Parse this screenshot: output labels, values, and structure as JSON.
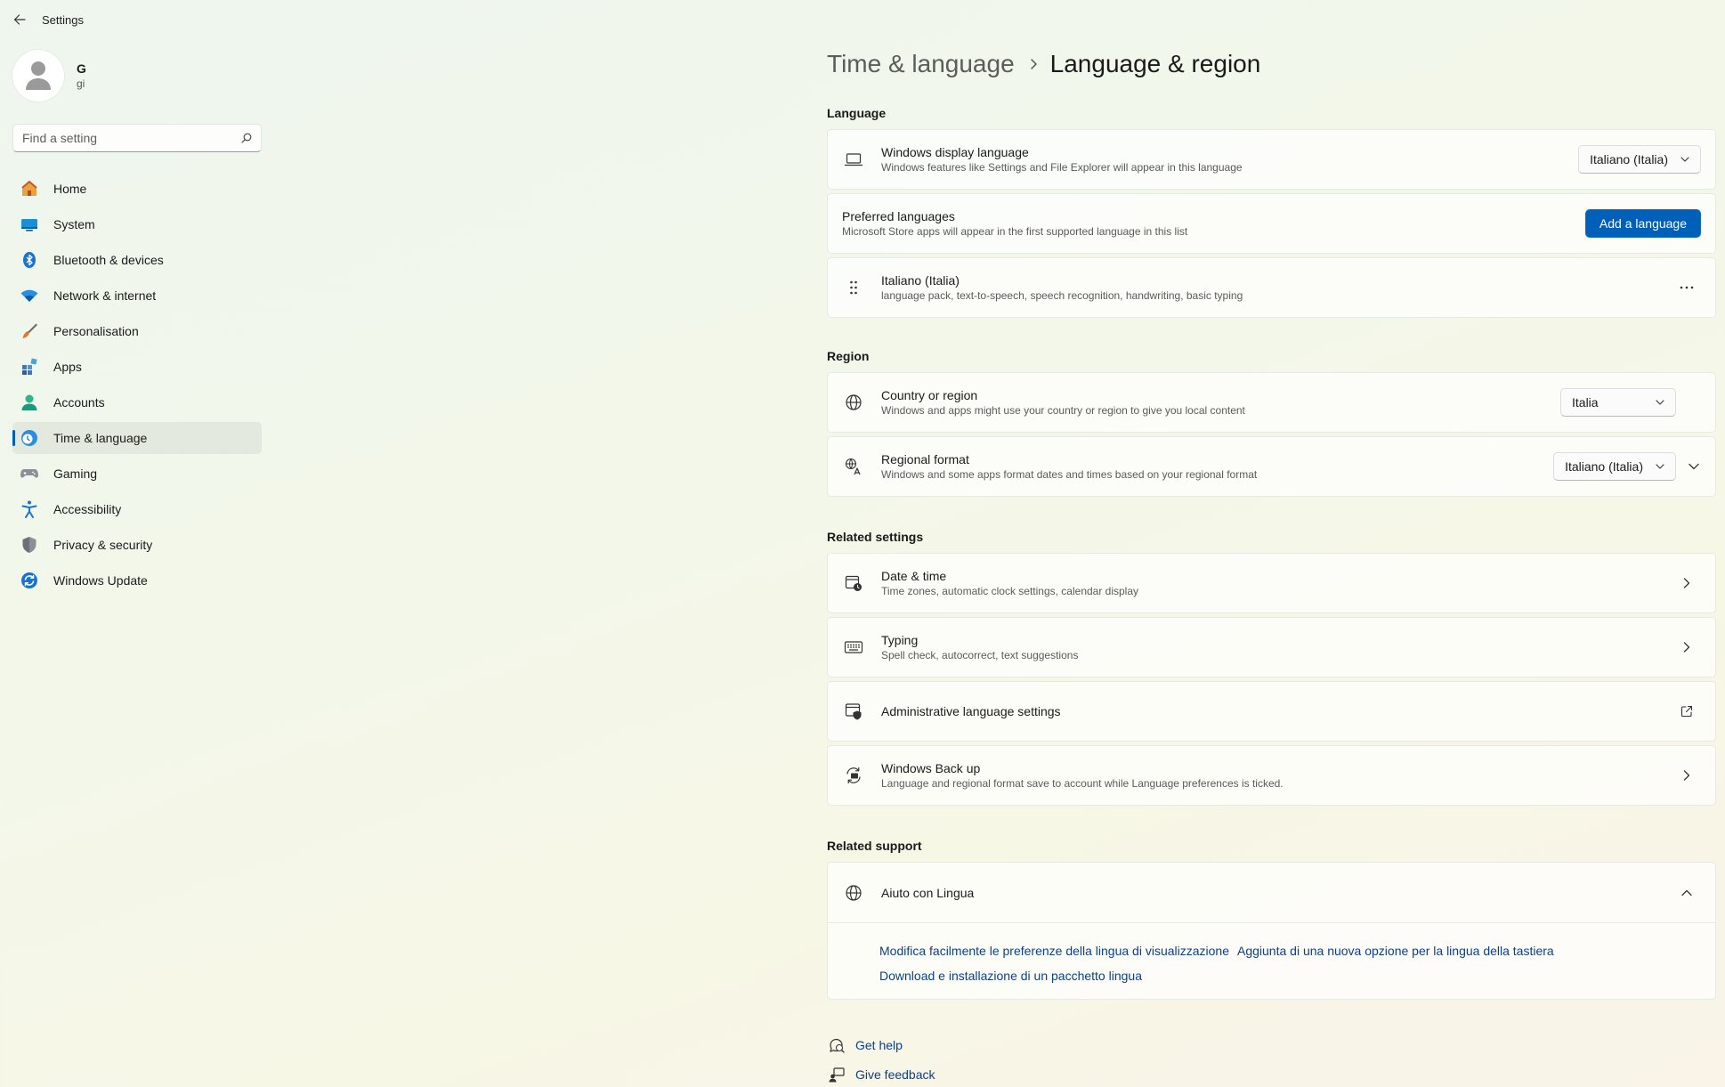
{
  "window": {
    "title": "Settings"
  },
  "profile": {
    "name": "G",
    "email": "gi"
  },
  "search": {
    "placeholder": "Find a setting"
  },
  "sidebar": {
    "items": [
      {
        "label": "Home",
        "icon": "home-icon"
      },
      {
        "label": "System",
        "icon": "system-icon"
      },
      {
        "label": "Bluetooth & devices",
        "icon": "bluetooth-icon"
      },
      {
        "label": "Network & internet",
        "icon": "wifi-icon"
      },
      {
        "label": "Personalisation",
        "icon": "brush-icon"
      },
      {
        "label": "Apps",
        "icon": "apps-icon"
      },
      {
        "label": "Accounts",
        "icon": "accounts-icon"
      },
      {
        "label": "Time & language",
        "icon": "time-language-icon",
        "active": true
      },
      {
        "label": "Gaming",
        "icon": "gamepad-icon"
      },
      {
        "label": "Accessibility",
        "icon": "accessibility-icon"
      },
      {
        "label": "Privacy & security",
        "icon": "shield-icon"
      },
      {
        "label": "Windows Update",
        "icon": "update-icon"
      }
    ]
  },
  "breadcrumb": {
    "parent": "Time & language",
    "current": "Language & region"
  },
  "language": {
    "section_label": "Language",
    "display_language": {
      "title": "Windows display language",
      "subtitle": "Windows features like Settings and File Explorer will appear in this language",
      "value": "Italiano (Italia)"
    },
    "preferred": {
      "title": "Preferred languages",
      "subtitle": "Microsoft Store apps will appear in the first supported language in this list",
      "button": "Add a language"
    },
    "installed": {
      "title": "Italiano (Italia)",
      "subtitle": "language pack, text-to-speech, speech recognition, handwriting, basic typing"
    }
  },
  "region": {
    "section_label": "Region",
    "country": {
      "title": "Country or region",
      "subtitle": "Windows and apps might use your country or region to give you local content",
      "value": "Italia"
    },
    "format": {
      "title": "Regional format",
      "subtitle": "Windows and some apps format dates and times based on your regional format",
      "value": "Italiano (Italia)"
    }
  },
  "related": {
    "section_label": "Related settings",
    "date_time": {
      "title": "Date & time",
      "subtitle": "Time zones, automatic clock settings, calendar display"
    },
    "typing": {
      "title": "Typing",
      "subtitle": "Spell check, autocorrect, text suggestions"
    },
    "admin": {
      "title": "Administrative language settings"
    },
    "backup": {
      "title": "Windows Back up",
      "subtitle": "Language and regional format save to account while Language preferences is ticked."
    }
  },
  "support": {
    "section_label": "Related support",
    "help_title": "Aiuto con Lingua",
    "links": [
      "Modifica facilmente le preferenze della lingua di visualizzazione",
      "Aggiunta di una nuova opzione per la lingua della tastiera",
      "Download e installazione di un pacchetto lingua"
    ]
  },
  "footer": {
    "get_help": "Get help",
    "give_feedback": "Give feedback"
  },
  "colors": {
    "accent": "#005fb8",
    "link": "#0b3f8a"
  }
}
